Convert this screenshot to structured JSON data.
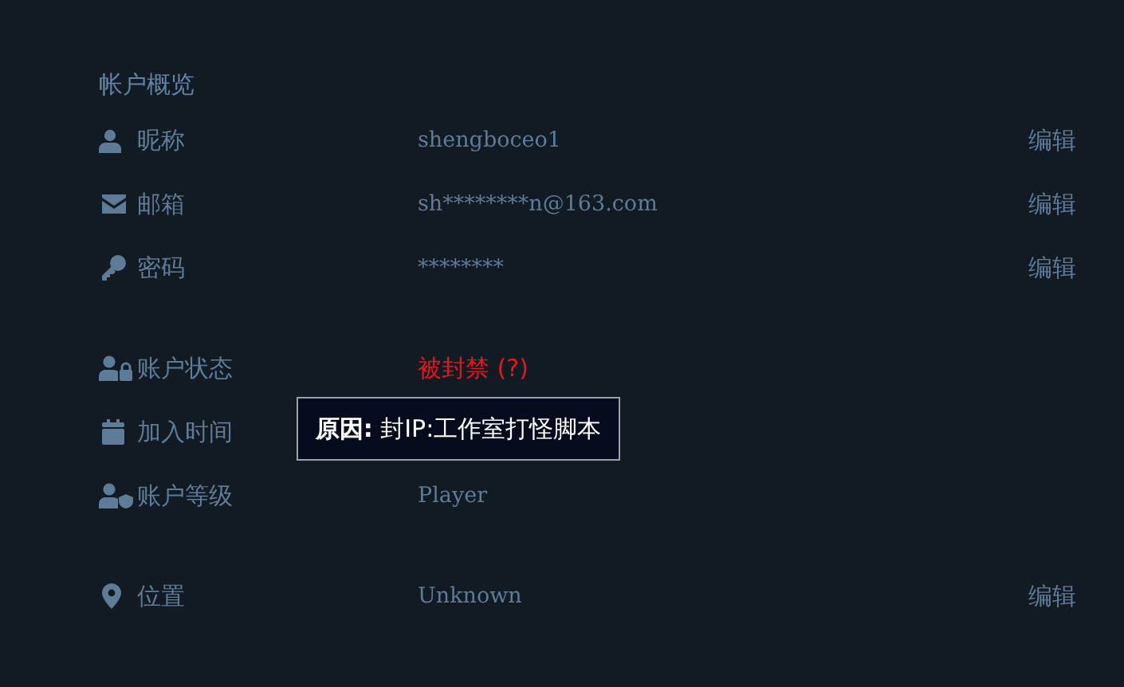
{
  "section_title": "帐户概览",
  "groups": [
    {
      "rows": [
        {
          "label": "昵称",
          "value": "shengboceo1",
          "alert": false,
          "edit": "编辑"
        },
        {
          "label": "邮箱",
          "value": "sh********n@163.com",
          "alert": false,
          "edit": "编辑"
        },
        {
          "label": "密码",
          "value": "********",
          "alert": false,
          "edit": "编辑"
        }
      ]
    },
    {
      "rows": [
        {
          "label": "账户状态",
          "value": "被封禁 (?)",
          "alert": true
        },
        {
          "label": "加入时间"
        },
        {
          "label": "账户等级",
          "value": "Player",
          "alert": false
        }
      ]
    },
    {
      "rows": [
        {
          "label": "位置",
          "value": "Unknown",
          "alert": false,
          "edit": "编辑"
        }
      ]
    }
  ],
  "tooltip": {
    "text": "**原因:** 封IP:工作室打怪脚本"
  }
}
